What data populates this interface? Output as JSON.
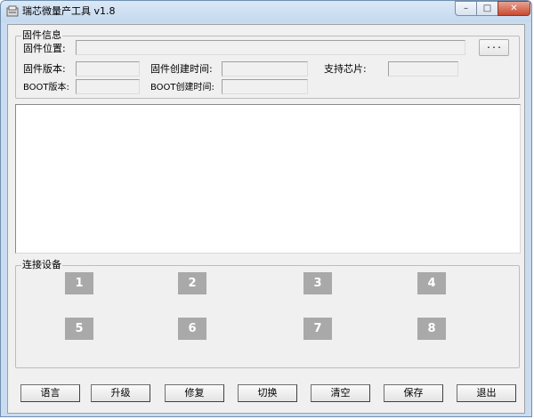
{
  "window": {
    "title": "瑞芯微量产工具 v1.8",
    "controls": {
      "minimize": "–",
      "maximize": "□",
      "close": "✕"
    }
  },
  "firmware_info": {
    "legend": "固件信息",
    "location_label": "固件位置:",
    "location_value": "",
    "browse_label": "...",
    "version_label": "固件版本:",
    "version_value": "",
    "created_label": "固件创建时间:",
    "created_value": "",
    "chip_label": "支持芯片:",
    "chip_value": "",
    "boot_version_label": "BOOT版本:",
    "boot_version_value": "",
    "boot_created_label": "BOOT创建时间:",
    "boot_created_value": ""
  },
  "log": {
    "content": ""
  },
  "devices": {
    "legend": "连接设备",
    "slots": [
      "1",
      "2",
      "3",
      "4",
      "5",
      "6",
      "7",
      "8"
    ]
  },
  "actions": {
    "language": "语言",
    "upgrade": "升级",
    "repair": "修复",
    "switch": "切换",
    "clear": "清空",
    "save": "保存",
    "exit": "退出"
  },
  "colors": {
    "device_slot_inactive": "#a9a9a9",
    "window_frame": "#c9dcf0",
    "close_button": "#c74a32"
  }
}
